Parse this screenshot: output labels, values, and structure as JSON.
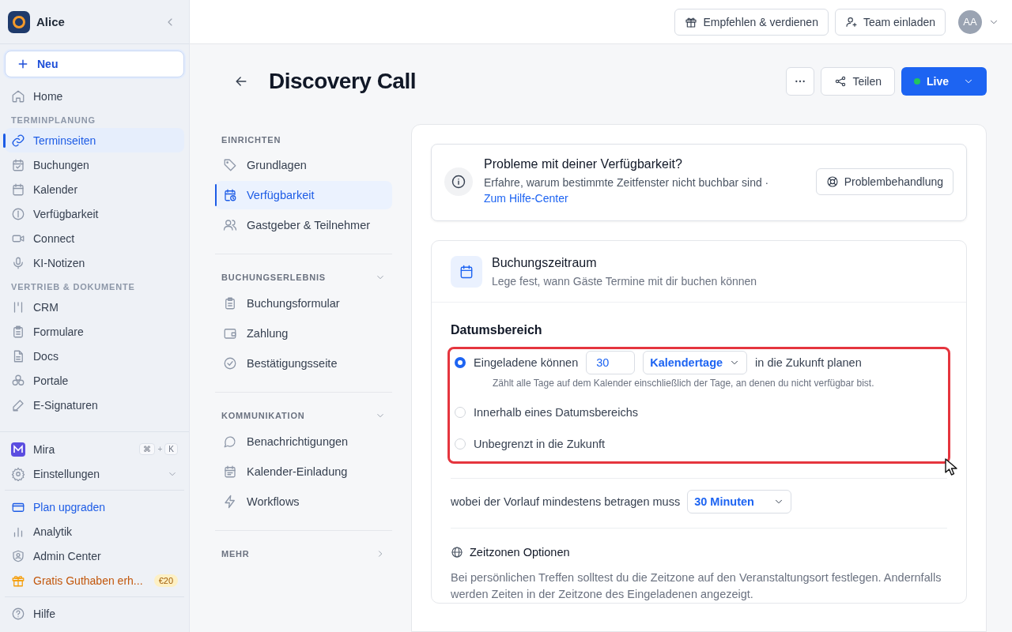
{
  "sidebar": {
    "workspace": "Alice",
    "new_button": "Neu",
    "top_items": [
      {
        "label": "Home",
        "selected": false
      }
    ],
    "sections": [
      {
        "title": "TERMINPLANUNG",
        "items": [
          {
            "label": "Terminseiten",
            "selected": true
          },
          {
            "label": "Buchungen",
            "selected": false
          },
          {
            "label": "Kalender",
            "selected": false
          },
          {
            "label": "Verfügbarkeit",
            "selected": false
          },
          {
            "label": "Connect",
            "selected": false
          },
          {
            "label": "KI-Notizen",
            "selected": false
          }
        ]
      },
      {
        "title": "VERTRIEB & DOKUMENTE",
        "items": [
          {
            "label": "CRM",
            "selected": false
          },
          {
            "label": "Formulare",
            "selected": false
          },
          {
            "label": "Docs",
            "selected": false
          },
          {
            "label": "Portale",
            "selected": false
          },
          {
            "label": "E-Signaturen",
            "selected": false
          }
        ]
      }
    ],
    "assistant": {
      "label": "Mira",
      "keys": [
        "⌘",
        "+",
        "K"
      ]
    },
    "settings": {
      "label": "Einstellungen",
      "expanded": true
    },
    "bottom_items": [
      {
        "label": "Plan upgraden",
        "kind": "upgrade"
      },
      {
        "label": "Analytik",
        "kind": "normal"
      },
      {
        "label": "Admin Center",
        "kind": "normal"
      },
      {
        "label": "Gratis Guthaben erh...",
        "kind": "promo",
        "badge": "€20"
      }
    ],
    "help": "Hilfe"
  },
  "topbar": {
    "buttons": [
      "Empfehlen & verdienen",
      "Team einladen"
    ],
    "avatar": "AA"
  },
  "header": {
    "title": "Discovery Call",
    "share": "Teilen",
    "status": {
      "label": "Live",
      "color": "#22c55e"
    }
  },
  "subnav": [
    {
      "title": "EINRICHTEN",
      "kind": "fixed",
      "items": [
        {
          "label": "Grundlagen",
          "selected": false
        },
        {
          "label": "Verfügbarkeit",
          "selected": true
        },
        {
          "label": "Gastgeber & Teilnehmer",
          "selected": false
        }
      ]
    },
    {
      "title": "BUCHUNGSERLEBNIS",
      "kind": "collapsible",
      "expanded": true,
      "items": [
        {
          "label": "Buchungsformular",
          "selected": false
        },
        {
          "label": "Zahlung",
          "selected": false
        },
        {
          "label": "Bestätigungsseite",
          "selected": false
        }
      ]
    },
    {
      "title": "KOMMUNIKATION",
      "kind": "collapsible",
      "expanded": true,
      "items": [
        {
          "label": "Benachrichtigungen",
          "selected": false
        },
        {
          "label": "Kalender-Einladung",
          "selected": false
        },
        {
          "label": "Workflows",
          "selected": false
        }
      ]
    },
    {
      "title": "MEHR",
      "kind": "collapsible",
      "expanded": false
    }
  ],
  "alert": {
    "title": "Probleme mit deiner Verfügbarkeit?",
    "text": "Erfahre, warum bestimmte Zeitfenster nicht buchbar sind ·",
    "link": "Zum Hilfe-Center",
    "button": "Problembehandlung"
  },
  "booking": {
    "title": "Buchungszeitraum",
    "subtitle": "Lege fest, wann Gäste Termine mit dir buchen können",
    "range": {
      "title": "Datumsbereich",
      "highlighted": true,
      "options": [
        {
          "kind": "rolling",
          "selected": true,
          "prefix": "Eingeladene können",
          "value": "30",
          "unit": "Kalendertage",
          "suffix": "in die Zukunft planen",
          "hint": "Zählt alle Tage auf dem Kalender einschließlich der Tage, an denen du nicht verfügbar bist."
        },
        {
          "kind": "simple",
          "selected": false,
          "label": "Innerhalb eines Datumsbereichs"
        },
        {
          "kind": "simple",
          "selected": false,
          "label": "Unbegrenzt in die Zukunft"
        }
      ]
    },
    "notice": {
      "label": "wobei der Vorlauf mindestens betragen muss",
      "value": "30 Minuten"
    },
    "timezone": {
      "title": "Zeitzonen Optionen",
      "text": "Bei persönlichen Treffen solltest du die Zeitzone auf den Veranstaltungsort festlegen. Andernfalls werden Zeiten in der Zeitzone des Eingeladenen angezeigt."
    }
  }
}
